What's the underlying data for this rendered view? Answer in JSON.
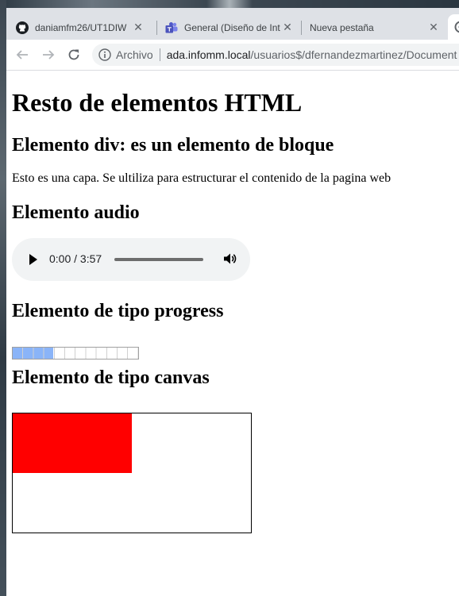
{
  "browser": {
    "tabs": [
      {
        "title": "daniamfm26/UT1DIW",
        "icon": "github-icon"
      },
      {
        "title": "General (Diseño de Int",
        "icon": "teams-icon"
      },
      {
        "title": "Nueva pestaña",
        "icon": ""
      }
    ],
    "omnibox": {
      "security_label": "Archivo",
      "host": "ada.infomm.local",
      "path": "/usuarios$/dfernandezmartinez/Document"
    }
  },
  "page": {
    "title": "Resto de elementos HTML",
    "div_heading": "Elemento div: es un elemento de bloque",
    "div_text": "Esto es una capa. Se ultiliza para estructurar el contenido de la pagina web",
    "audio_heading": "Elemento audio",
    "audio_time": "0:00 / 3:57",
    "progress_heading": "Elemento de tipo progress",
    "progress_value": 0.32,
    "canvas_heading": "Elemento de tipo canvas",
    "canvas_fill_color": "#ff0000"
  }
}
